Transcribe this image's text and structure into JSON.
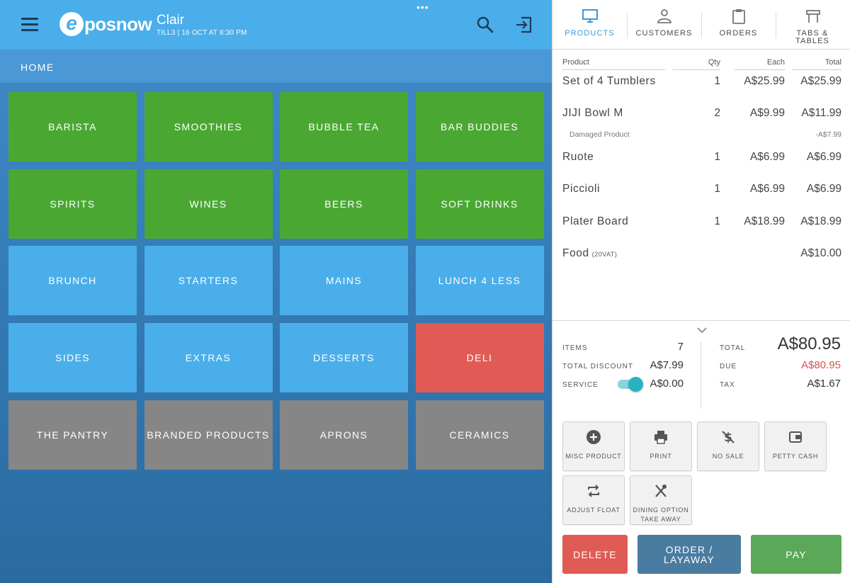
{
  "header": {
    "logo_letter": "e",
    "logo_text": "posnow",
    "user_name": "Clair",
    "till_info": "TILL3 | 16 OCT AT 8:30 PM",
    "dots": "•••",
    "breadcrumb": "HOME"
  },
  "colors": {
    "topbar": "#4aaeea",
    "green_tile": "#4aa832",
    "blue_tile": "#4aaeea",
    "red_tile": "#e05b55",
    "grey_tile": "#868686",
    "accent": "#3a9ad9",
    "due_red": "#d9534f"
  },
  "categories": [
    {
      "label": "BARISTA",
      "color": "green"
    },
    {
      "label": "SMOOTHIES",
      "color": "green"
    },
    {
      "label": "BUBBLE TEA",
      "color": "green"
    },
    {
      "label": "BAR BUDDIES",
      "color": "green"
    },
    {
      "label": "SPIRITS",
      "color": "green"
    },
    {
      "label": "WINES",
      "color": "green"
    },
    {
      "label": "BEERS",
      "color": "green"
    },
    {
      "label": "SOFT DRINKS",
      "color": "green"
    },
    {
      "label": "BRUNCH",
      "color": "blue"
    },
    {
      "label": "STARTERS",
      "color": "blue"
    },
    {
      "label": "MAINS",
      "color": "blue"
    },
    {
      "label": "LUNCH 4 LESS",
      "color": "blue"
    },
    {
      "label": "SIDES",
      "color": "blue"
    },
    {
      "label": "EXTRAS",
      "color": "blue"
    },
    {
      "label": "DESSERTS",
      "color": "blue"
    },
    {
      "label": "DELI",
      "color": "red"
    },
    {
      "label": "THE PANTRY",
      "color": "grey"
    },
    {
      "label": "BRANDED PRODUCTS",
      "color": "grey"
    },
    {
      "label": "APRONS",
      "color": "grey"
    },
    {
      "label": "CERAMICS",
      "color": "grey"
    }
  ],
  "tabs": [
    {
      "label": "PRODUCTS",
      "icon": "monitor-icon",
      "active": true
    },
    {
      "label": "CUSTOMERS",
      "icon": "person-icon",
      "active": false
    },
    {
      "label": "ORDERS",
      "icon": "clipboard-icon",
      "active": false
    },
    {
      "label": "TABS & TABLES",
      "icon": "table-icon",
      "active": false
    }
  ],
  "cart": {
    "headers": {
      "product": "Product",
      "qty": "Qty",
      "each": "Each",
      "total": "Total"
    },
    "items": [
      {
        "name": "Set of 4 Tumblers",
        "qty": "1",
        "each": "A$25.99",
        "total": "A$25.99"
      },
      {
        "name": "JIJI Bowl M",
        "qty": "2",
        "each": "A$9.99",
        "total": "A$11.99",
        "sub_label": "Damaged Product",
        "sub_value": "-A$7.99"
      },
      {
        "name": "Ruote",
        "qty": "1",
        "each": "A$6.99",
        "total": "A$6.99"
      },
      {
        "name": "Piccioli",
        "qty": "1",
        "each": "A$6.99",
        "total": "A$6.99"
      },
      {
        "name": "Plater Board",
        "qty": "1",
        "each": "A$18.99",
        "total": "A$18.99"
      },
      {
        "name": "Food",
        "tag": "(20VAT)",
        "qty": "",
        "each": "",
        "total": "A$10.00"
      }
    ]
  },
  "summary": {
    "items_label": "ITEMS",
    "items_value": "7",
    "discount_label": "TOTAL DISCOUNT",
    "discount_value": "A$7.99",
    "service_label": "SERVICE",
    "service_value": "A$0.00",
    "service_on": true,
    "total_label": "TOTAL",
    "total_value": "A$80.95",
    "due_label": "DUE",
    "due_value": "A$80.95",
    "tax_label": "TAX",
    "tax_value": "A$1.67"
  },
  "functions": [
    {
      "label": "MISC PRODUCT",
      "icon": "plus-circle-icon"
    },
    {
      "label": "PRINT",
      "icon": "printer-icon"
    },
    {
      "label": "NO SALE",
      "icon": "no-money-icon"
    },
    {
      "label": "PETTY CASH",
      "icon": "wallet-icon"
    },
    {
      "label": "ADJUST FLOAT",
      "icon": "repeat-icon"
    },
    {
      "label_line1": "DINING OPTION",
      "label_line2": "TAKE AWAY",
      "icon": "utensils-icon"
    }
  ],
  "actions": {
    "delete": "DELETE",
    "order_line1": "ORDER /",
    "order_line2": "LAYAWAY",
    "pay": "PAY"
  }
}
